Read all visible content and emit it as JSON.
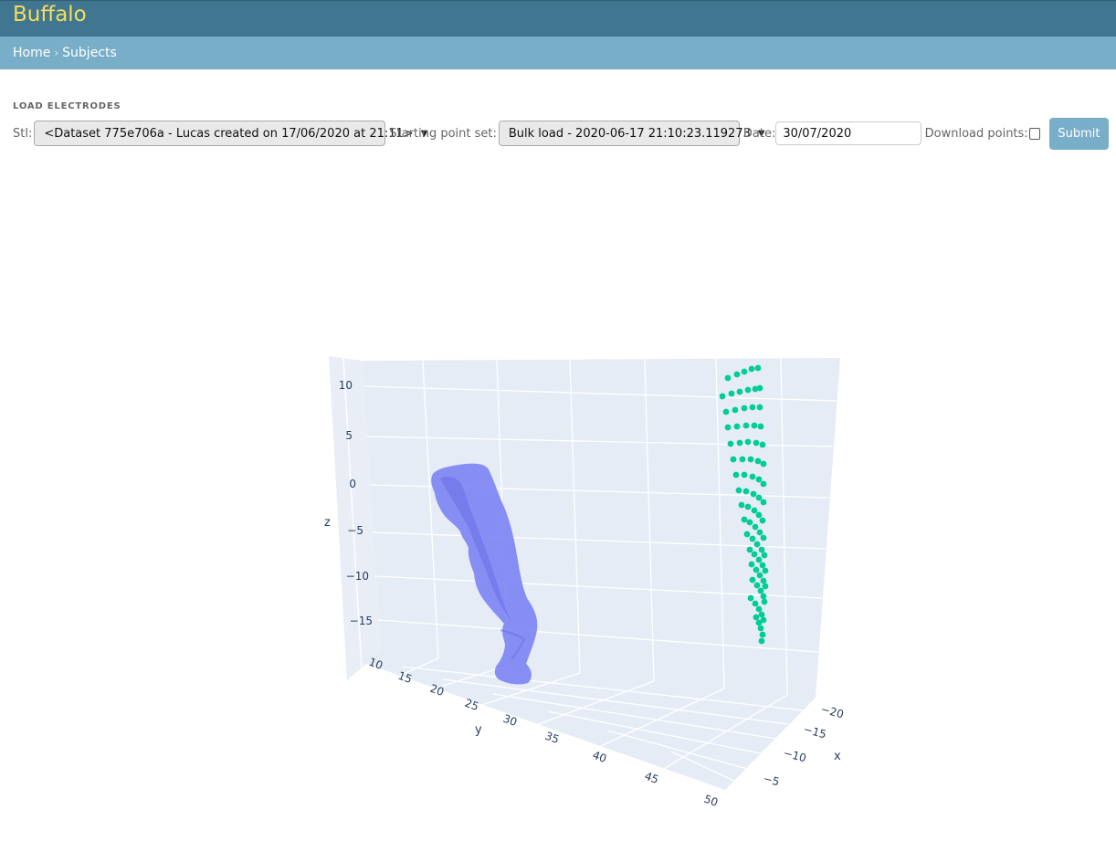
{
  "header": {
    "title": "Buffalo"
  },
  "breadcrumbs": {
    "home": "Home",
    "separator": "›",
    "current": "Subjects"
  },
  "form": {
    "section_title": "LOAD ELECTRODES",
    "stl_label": "Stl:",
    "stl_value": "<Dataset 775e706a - Lucas created on 17/06/2020 at 21:11>",
    "point_set_label": "Starting point set:",
    "point_set_value": "Bulk load - 2020-06-17 21:10:23.119273",
    "date_label": "Date:",
    "date_value": "30/07/2020",
    "download_label": "Download points:",
    "download_checked": false,
    "submit_label": "Submit"
  },
  "plot": {
    "axes": {
      "z": {
        "title": "z",
        "ticks": [
          "10",
          "5",
          "0",
          "−5",
          "−10",
          "−15"
        ]
      },
      "y": {
        "title": "y",
        "ticks": [
          "10",
          "15",
          "20",
          "25",
          "30",
          "35",
          "40",
          "45",
          "50"
        ]
      },
      "x": {
        "title": "x",
        "ticks": [
          "−20",
          "−15",
          "−10",
          "−5"
        ]
      }
    },
    "colors": {
      "background": "#e5ecf6",
      "grid": "#ffffff",
      "mesh": "#7b84f4",
      "points": "#00cc96"
    }
  }
}
